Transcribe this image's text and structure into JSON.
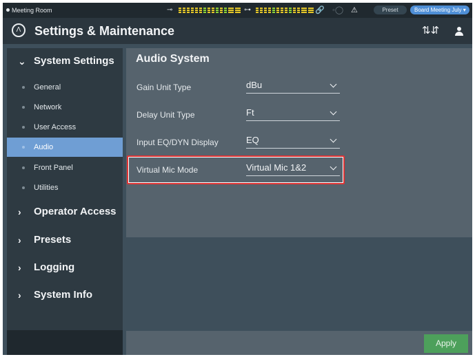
{
  "status_bar": {
    "room": "Meeting Room",
    "preset_label": "Preset",
    "preset_value": "Board Meeting July ▾"
  },
  "title_bar": {
    "title": "Settings & Maintenance"
  },
  "sidebar": {
    "system_settings": "System Settings",
    "items": [
      {
        "label": "General"
      },
      {
        "label": "Network"
      },
      {
        "label": "User Access"
      },
      {
        "label": "Audio"
      },
      {
        "label": "Front Panel"
      },
      {
        "label": "Utilities"
      }
    ],
    "active_item": "Audio",
    "groups": [
      {
        "label": "Operator Access"
      },
      {
        "label": "Presets"
      },
      {
        "label": "Logging"
      },
      {
        "label": "System Info"
      }
    ]
  },
  "main": {
    "section_title": "Audio System",
    "rows": [
      {
        "label": "Gain Unit Type",
        "value": "dBu"
      },
      {
        "label": "Delay Unit Type",
        "value": "Ft"
      },
      {
        "label": "Input EQ/DYN Display",
        "value": "EQ"
      },
      {
        "label": "Virtual Mic Mode",
        "value": "Virtual Mic 1&2"
      }
    ],
    "apply_label": "Apply"
  },
  "colors": {
    "accent": "#6f9ed4",
    "highlight": "#e03434",
    "apply": "#4da05b",
    "preset_pill": "#4f8fd6"
  }
}
